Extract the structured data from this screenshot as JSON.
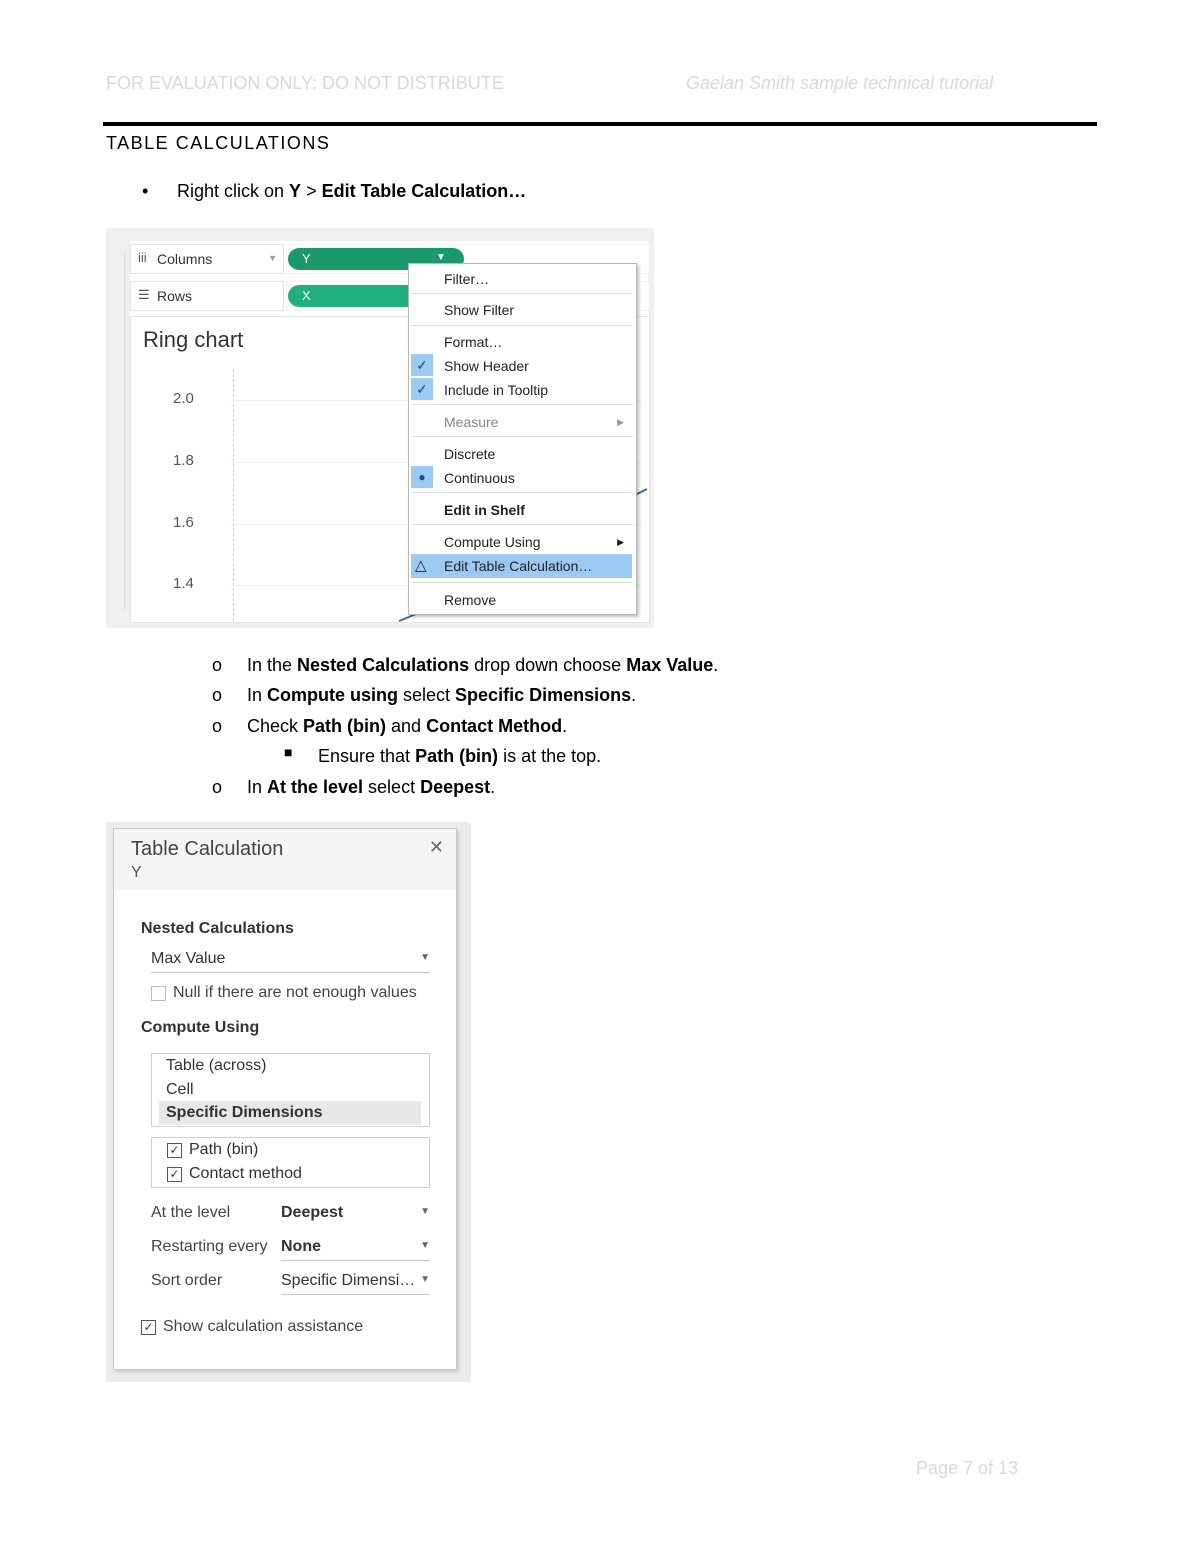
{
  "header": {
    "left": "FOR EVALUATION ONLY: DO NOT DISTRIBUTE",
    "right": "Gaelan Smith sample technical tutorial"
  },
  "section_title": "TABLE CALCULATIONS",
  "step1": {
    "pre": "Right click on ",
    "b1": "Y",
    "mid": " > ",
    "b2": "Edit Table Calculation…"
  },
  "screenshot1": {
    "columns_label": "Columns",
    "rows_label": "Rows",
    "columns_pill": "Y",
    "rows_pill": "X",
    "pill_colors": {
      "columns": "#1a9a6a",
      "rows": "#20b07e"
    },
    "chart_title": "Ring chart",
    "y_ticks": [
      "2.0",
      "1.8",
      "1.6",
      "1.4"
    ],
    "menu": {
      "filter": "Filter…",
      "show_filter": "Show Filter",
      "format": "Format…",
      "show_header": "Show Header",
      "include_tooltip": "Include in Tooltip",
      "measure": "Measure",
      "discrete": "Discrete",
      "continuous": "Continuous",
      "edit_in_shelf": "Edit in Shelf",
      "compute_using": "Compute Using",
      "edit_table_calc": "Edit Table Calculation…",
      "remove": "Remove"
    }
  },
  "substeps": [
    {
      "pre": "In the ",
      "b1": "Nested Calculations",
      "mid": " drop down choose ",
      "b2": "Max Value",
      "post": "."
    },
    {
      "pre": "In ",
      "b1": "Compute using",
      "mid": " select ",
      "b2": "Specific Dimensions",
      "post": "."
    },
    {
      "pre": "Check ",
      "b1": "Path (bin)",
      "mid": " and ",
      "b2": "Contact Method",
      "post": "."
    },
    {
      "pre": "Ensure that ",
      "b1": "Path (bin)",
      "post": " is at the top."
    },
    {
      "pre": "In ",
      "b1": "At the level",
      "mid": " select ",
      "b2": "Deepest",
      "post": "."
    }
  ],
  "screenshot2": {
    "title": "Table Calculation",
    "subtitle": "Y",
    "nested_label": "Nested Calculations",
    "nested_value": "Max Value",
    "null_checkbox": "Null if there are not enough values",
    "compute_label": "Compute Using",
    "compute_options": [
      "Table (across)",
      "Cell",
      "Specific Dimensions"
    ],
    "dimensions": [
      "Path (bin)",
      "Contact method"
    ],
    "at_level_label": "At the level",
    "at_level_value": "Deepest",
    "restarting_label": "Restarting every",
    "restarting_value": "None",
    "sort_label": "Sort order",
    "sort_value": "Specific Dimensi…",
    "assist_checkbox": "Show calculation assistance"
  },
  "footer": "Page 7 of 13"
}
